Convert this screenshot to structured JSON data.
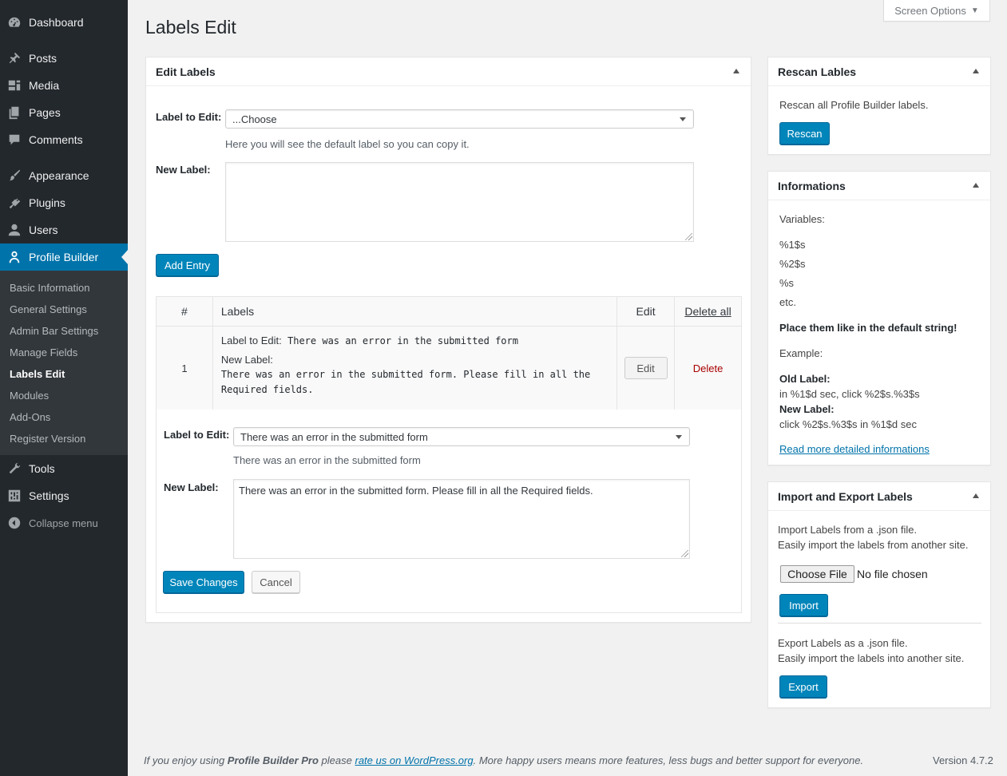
{
  "sidebar": {
    "items": [
      {
        "label": "Dashboard",
        "icon": "dashboard-icon"
      },
      {
        "label": "Posts",
        "icon": "pin-icon"
      },
      {
        "label": "Media",
        "icon": "media-icon"
      },
      {
        "label": "Pages",
        "icon": "pages-icon"
      },
      {
        "label": "Comments",
        "icon": "comment-icon"
      },
      {
        "label": "Appearance",
        "icon": "brush-icon"
      },
      {
        "label": "Plugins",
        "icon": "plug-icon"
      },
      {
        "label": "Users",
        "icon": "users-icon"
      },
      {
        "label": "Profile Builder",
        "icon": "user-icon"
      }
    ],
    "submenu": [
      "Basic Information",
      "General Settings",
      "Admin Bar Settings",
      "Manage Fields",
      "Labels Edit",
      "Modules",
      "Add-Ons",
      "Register Version"
    ],
    "current_submenu": "Labels Edit",
    "bottom_items": [
      {
        "label": "Tools",
        "icon": "wrench-icon"
      },
      {
        "label": "Settings",
        "icon": "settings-icon"
      }
    ],
    "collapse_label": "Collapse menu"
  },
  "screen_options": "Screen Options",
  "page_title": "Labels Edit",
  "edit_labels": {
    "title": "Edit Labels",
    "label_to_edit": "Label to Edit:",
    "select_value": "...Choose",
    "select_hint": "Here you will see the default label so you can copy it.",
    "new_label": "New Label:",
    "new_label_value": "",
    "add_entry": "Add Entry",
    "table": {
      "col_num": "#",
      "col_labels": "Labels",
      "col_edit": "Edit",
      "col_delete_all": "Delete all",
      "rows": [
        {
          "num": "1",
          "label_to_edit_title": "Label to Edit:",
          "label_to_edit_value": "There was an error in the submitted form",
          "new_label_title": "New Label:",
          "new_label_line1": "There was an error in the submitted form. Please fill in all the",
          "new_label_line2": "Required fields.",
          "edit": "Edit",
          "delete": "Delete"
        }
      ]
    },
    "edit_form": {
      "label_to_edit": "Label to Edit:",
      "select_value": "There was an error in the submitted form",
      "select_hint": "There was an error in the submitted form",
      "new_label": "New Label:",
      "new_label_value": "There was an error in the submitted form. Please fill in all the Required fields.",
      "save": "Save Changes",
      "cancel": "Cancel"
    }
  },
  "rescan": {
    "title": "Rescan Lables",
    "text": "Rescan all Profile Builder labels.",
    "button": "Rescan"
  },
  "informations": {
    "title": "Informations",
    "variables_label": "Variables:",
    "variables": [
      "%1$s",
      "%2$s",
      "%s",
      "etc."
    ],
    "place_note": "Place them like in the default string!",
    "example_label": "Example:",
    "old_label_title": "Old Label:",
    "old_label_value": "in %1$d sec, click %2$s.%3$s",
    "new_label_title": "New Label:",
    "new_label_value": "click %2$s.%3$s in %1$d sec",
    "read_more": "Read more detailed informations"
  },
  "import_export": {
    "title": "Import and Export Labels",
    "import_line1": "Import Labels from a .json file.",
    "import_line2": "Easily import the labels from another site.",
    "choose_file": "Choose File",
    "no_file": "No file chosen",
    "import_button": "Import",
    "export_line1": "Export Labels as a .json file.",
    "export_line2": "Easily import the labels into another site.",
    "export_button": "Export"
  },
  "footer": {
    "prefix": "If you enjoy using ",
    "product": "Profile Builder Pro",
    "middle": " please ",
    "link": "rate us on WordPress.org",
    "suffix": ". More happy users means more features, less bugs and better support for everyone.",
    "version": "Version 4.7.2"
  },
  "colors": {
    "sidebar_bg": "#23282d",
    "submenu_bg": "#32373c",
    "accent": "#0073aa",
    "primary_button": "#0085ba",
    "delete_red": "#a00"
  }
}
